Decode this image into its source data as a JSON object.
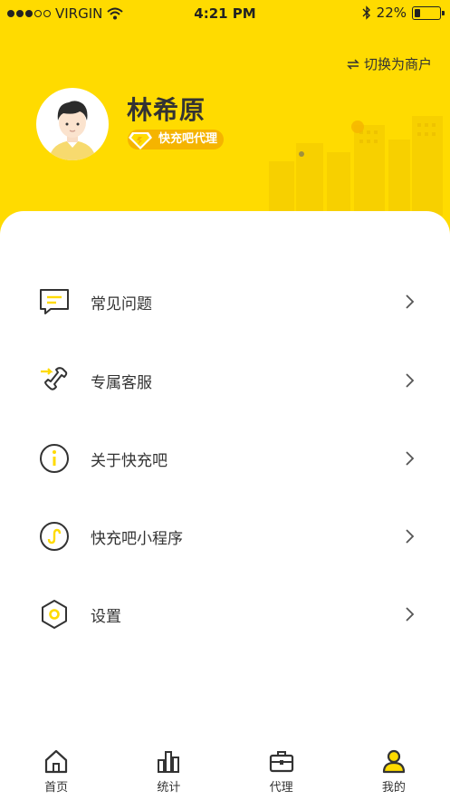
{
  "status_bar": {
    "carrier": "●●●○○ VIRGIN",
    "time": "4:21 PM",
    "battery_level": "22%"
  },
  "header": {
    "switch_label": "切换为商户",
    "user_name": "林希原",
    "badge_label": "快充吧代理",
    "accent_color": "#FFDB00",
    "badge_color": "#F5B400"
  },
  "menu": {
    "items": [
      {
        "label": "常见问题",
        "icon": "faq-message-icon"
      },
      {
        "label": "专属客服",
        "icon": "phone-icon"
      },
      {
        "label": "关于快充吧",
        "icon": "info-icon"
      },
      {
        "label": "快充吧小程序",
        "icon": "mini-program-icon"
      },
      {
        "label": "设置",
        "icon": "settings-hexagon-icon"
      }
    ]
  },
  "tabbar": {
    "items": [
      {
        "label": "首页",
        "icon": "home-icon"
      },
      {
        "label": "统计",
        "icon": "stats-icon"
      },
      {
        "label": "代理",
        "icon": "briefcase-icon"
      },
      {
        "label": "我的",
        "icon": "user-icon",
        "active": true
      }
    ]
  }
}
